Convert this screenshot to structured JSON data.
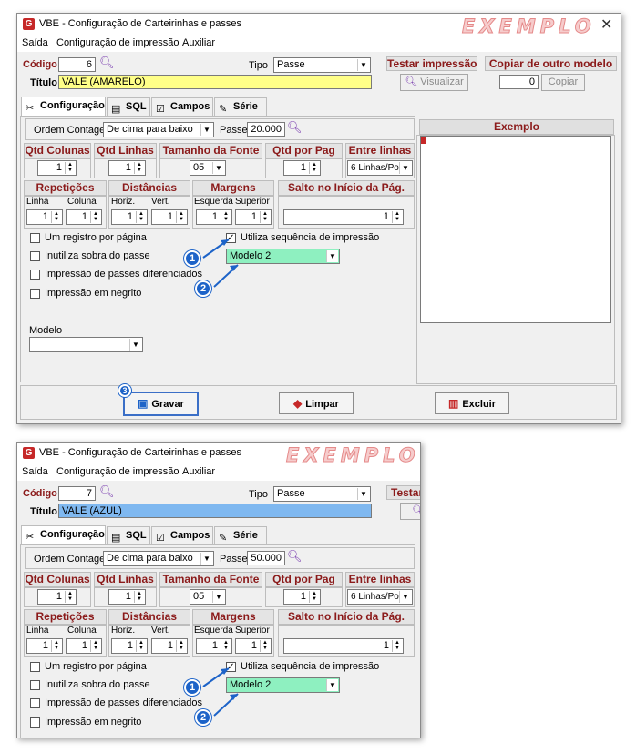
{
  "window1": {
    "title": "VBE - Configuração de Carteirinhas e passes",
    "watermark": "EXEMPLO",
    "close": "✕",
    "menu": [
      "Saída",
      "Configuração de impressão",
      "Auxiliar"
    ],
    "codigo_label": "Código",
    "codigo_value": "6",
    "tipo_label": "Tipo",
    "tipo_value": "Passe",
    "titulo_label": "Título",
    "titulo_value": "VALE              (AMARELO)",
    "titulo_color": "#ffff88",
    "testar_impressao": "Testar impressão",
    "visualizar": "Visualizar",
    "copiar_outro_modelo": "Copiar de outro modelo",
    "copiar_value": "0",
    "copiar_button": "Copiar",
    "tabs": [
      "Configuração",
      "SQL",
      "Campos",
      "Série"
    ],
    "ordem_label": "Ordem Contagem",
    "ordem_value": "De cima para baixo",
    "passe_label": "Passe",
    "passe_value": "20.000",
    "qtd_colunas": "Qtd Colunas",
    "qtd_linhas": "Qtd Linhas",
    "tamanho_fonte": "Tamanho da Fonte",
    "qtd_por_pag": "Qtd por Pag",
    "entre_linhas": "Entre linhas",
    "qtd_colunas_val": "1",
    "qtd_linhas_val": "1",
    "fonte_val": "05",
    "qtd_por_pag_val": "1",
    "entre_linhas_val": "6 Linhas/Pol",
    "repeticoes": "Repetições",
    "linha": "Linha",
    "coluna": "Coluna",
    "linha_val": "1",
    "coluna_val": "1",
    "distancias": "Distâncias",
    "horiz": "Horiz.",
    "vert": "Vert.",
    "horiz_val": "1",
    "vert_val": "1",
    "margens": "Margens",
    "esquerda": "Esquerda",
    "superior": "Superior",
    "esquerda_val": "1",
    "superior_val": "1",
    "salto": "Salto no Início da Pág.",
    "salto_val": "1",
    "chk_um_registro": "Um registro por página",
    "chk_inutiliza": "Inutiliza sobra do passe",
    "chk_impressao_passes": "Impressão de passes diferenciados",
    "chk_negrito": "Impressão em negrito",
    "chk_utiliza_seq": "Utiliza sequência de impressão",
    "seq_modelo": "Modelo 2",
    "modelo_label": "Modelo",
    "modelo_value": "",
    "exemplo": "Exemplo",
    "gravar": "Gravar",
    "limpar": "Limpar",
    "excluir": "Excluir",
    "callouts": [
      "1",
      "2",
      "3"
    ]
  },
  "window2": {
    "title": "VBE - Configuração de Carteirinhas e passes",
    "watermark": "EXEMPLO",
    "menu": [
      "Saída",
      "Configuração de impressão",
      "Auxiliar"
    ],
    "codigo_label": "Código",
    "codigo_value": "7",
    "tipo_label": "Tipo",
    "tipo_value": "Passe",
    "titulo_label": "Título",
    "titulo_value": "VALE              (AZUL)",
    "titulo_color": "#7fb8f0",
    "testar_impressao": "Testar",
    "tabs": [
      "Configuração",
      "SQL",
      "Campos",
      "Série"
    ],
    "ordem_label": "Ordem Contagem",
    "ordem_value": "De cima para baixo",
    "passe_label": "Passe",
    "passe_value": "50.000",
    "qtd_colunas": "Qtd Colunas",
    "qtd_linhas": "Qtd Linhas",
    "tamanho_fonte": "Tamanho da Fonte",
    "qtd_por_pag": "Qtd por Pag",
    "entre_linhas": "Entre linhas",
    "qtd_colunas_val": "1",
    "qtd_linhas_val": "1",
    "fonte_val": "05",
    "qtd_por_pag_val": "1",
    "entre_linhas_val": "6 Linhas/Pol",
    "repeticoes": "Repetições",
    "linha": "Linha",
    "coluna": "Coluna",
    "linha_val": "1",
    "coluna_val": "1",
    "distancias": "Distâncias",
    "horiz": "Horiz.",
    "vert": "Vert.",
    "horiz_val": "1",
    "vert_val": "1",
    "margens": "Margens",
    "esquerda": "Esquerda",
    "superior": "Superior",
    "esquerda_val": "1",
    "superior_val": "1",
    "salto": "Salto no Início da Pág.",
    "salto_val": "1",
    "chk_um_registro": "Um registro por página",
    "chk_inutiliza": "Inutiliza sobra do passe",
    "chk_impressao_passes": "Impressão de passes diferenciados",
    "chk_negrito": "Impressão em negrito",
    "chk_utiliza_seq": "Utiliza sequência de impressão",
    "seq_modelo": "Modelo 2",
    "callouts": [
      "1",
      "2"
    ]
  },
  "colors": {
    "group_header_text": "#8b1a1a",
    "seq_combo_bg": "#8ef0c0",
    "callout_blue": "#1d63c8",
    "magnifier": "#7b3fb0"
  }
}
